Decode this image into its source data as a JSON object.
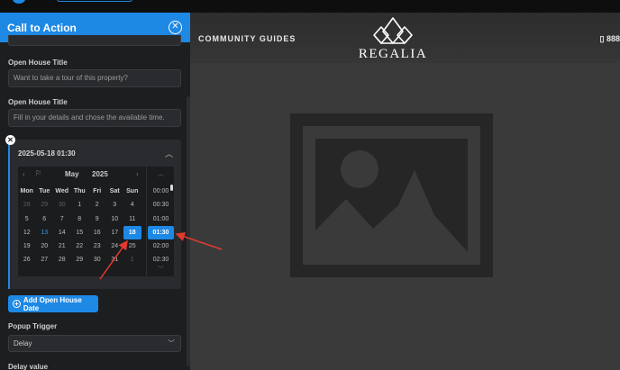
{
  "panel": {
    "title": "Call to Action",
    "fields": [
      {
        "label": "Open House Title",
        "value": "Want to take a tour of this property?"
      },
      {
        "label": "Open House Title",
        "value": "Fill in your details and chose the available time."
      }
    ],
    "date_entry": {
      "value": "2025-05-18 01:30",
      "calendar": {
        "month": "May",
        "year": "2025",
        "weekdays": [
          "Mon",
          "Tue",
          "Wed",
          "Thu",
          "Fri",
          "Sat",
          "Sun"
        ],
        "weeks": [
          [
            {
              "d": "28",
              "m": true
            },
            {
              "d": "29",
              "m": true
            },
            {
              "d": "30",
              "m": true
            },
            {
              "d": "1"
            },
            {
              "d": "2"
            },
            {
              "d": "3"
            },
            {
              "d": "4"
            }
          ],
          [
            {
              "d": "5"
            },
            {
              "d": "6"
            },
            {
              "d": "7"
            },
            {
              "d": "8"
            },
            {
              "d": "9"
            },
            {
              "d": "10"
            },
            {
              "d": "11"
            }
          ],
          [
            {
              "d": "12"
            },
            {
              "d": "13",
              "t": true
            },
            {
              "d": "14"
            },
            {
              "d": "15"
            },
            {
              "d": "16"
            },
            {
              "d": "17"
            },
            {
              "d": "18",
              "s": true
            }
          ],
          [
            {
              "d": "19"
            },
            {
              "d": "20"
            },
            {
              "d": "21"
            },
            {
              "d": "22"
            },
            {
              "d": "23"
            },
            {
              "d": "24"
            },
            {
              "d": "25"
            }
          ],
          [
            {
              "d": "26"
            },
            {
              "d": "27"
            },
            {
              "d": "28"
            },
            {
              "d": "29"
            },
            {
              "d": "30"
            },
            {
              "d": "31"
            },
            {
              "d": "1",
              "m": true
            }
          ]
        ]
      },
      "times": [
        "00:00",
        "00:30",
        "01:00",
        "01:30",
        "02:00",
        "02:30"
      ],
      "selected_time": "01:30"
    },
    "add_button": "Add Open House Date",
    "popup_trigger": {
      "label": "Popup Trigger",
      "value": "Delay"
    },
    "delay_label": "Delay value"
  },
  "preview": {
    "nav_link": "COMMUNITY GUIDES",
    "logo_text": "REGALIA",
    "phone": "▯ 888"
  },
  "colors": {
    "accent": "#1e88e5",
    "annotation": "#e03a2f"
  }
}
